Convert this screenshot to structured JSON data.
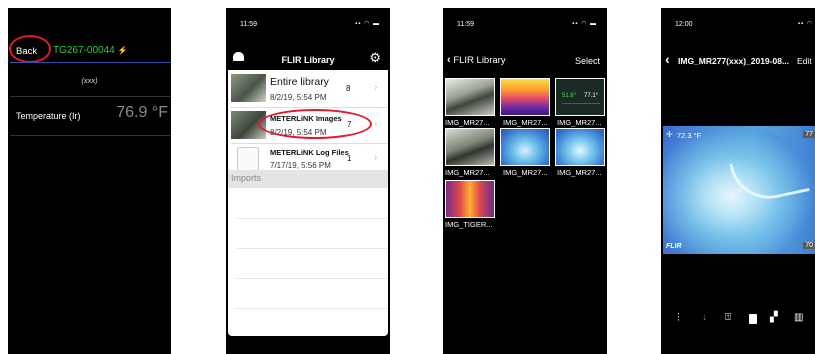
{
  "phone1": {
    "back_label": "Back",
    "device_name": "TG267-00044",
    "subtitle": "(xxx)",
    "reading_label": "Temperature (Ir)",
    "reading_value": "76.9 °F",
    "colors": {
      "accent": "#2ecc40",
      "annotation": "#e0192d",
      "divider": "#2f4fa8"
    }
  },
  "phone2": {
    "time": "11:59",
    "header_title": "FLIR Library",
    "items": [
      {
        "title": "Entire library",
        "date": "8/2/19, 5:54 PM",
        "count": "8"
      },
      {
        "title": "METERLiNK Images",
        "date": "8/2/19, 5:54 PM",
        "count": "7"
      },
      {
        "title": "METERLiNK Log Files",
        "date": "7/17/19, 5:56 PM",
        "count": "1"
      }
    ],
    "section_label": "Imports"
  },
  "phone3": {
    "time": "11:59",
    "back_label": "FLIR Library",
    "select_label": "Select",
    "thumbnails": [
      {
        "label": "IMG_MR27..."
      },
      {
        "label": "IMG_MR27..."
      },
      {
        "label": "IMG_MR27..."
      },
      {
        "label": "IMG_MR27..."
      },
      {
        "label": "IMG_MR27..."
      },
      {
        "label": "IMG_MR27..."
      },
      {
        "label": "IMG_TIGER..."
      }
    ]
  },
  "phone4": {
    "time": "12:00",
    "title": "IMG_MR277(xxx)_2019-08...",
    "edit_label": "Edit",
    "spot_reading": "72.3 °F",
    "scale_top": "77",
    "scale_bottom": "70",
    "brand": "FLIR",
    "toolbar_icons": [
      "adjust-icon",
      "download-icon",
      "share-icon",
      "pdf-icon",
      "map-icon",
      "trash-icon"
    ]
  }
}
